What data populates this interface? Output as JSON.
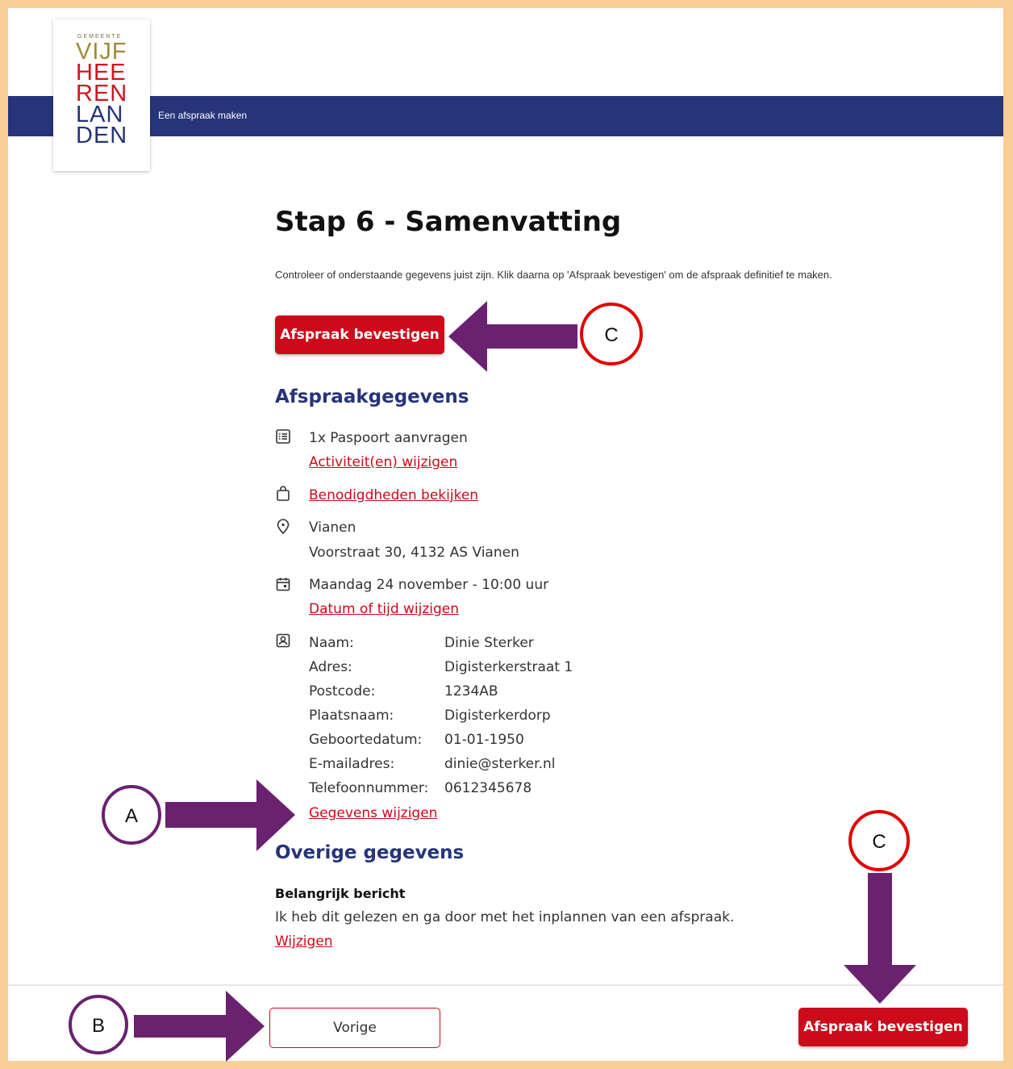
{
  "header": {
    "title": "Een afspraak maken",
    "logo": {
      "small": "GEMEENTE",
      "lines": [
        "VIJF",
        "HEE",
        "REN",
        "LAN",
        "DEN"
      ]
    }
  },
  "page": {
    "title": "Stap 6 - Samenvatting",
    "intro": "Controleer of onderstaande gegevens juist zijn. Klik daarna op 'Afspraak bevestigen' om de afspraak definitief te maken.",
    "confirm_label": "Afspraak bevestigen"
  },
  "afspraak": {
    "heading": "Afspraakgegevens",
    "activity": "1x Paspoort aanvragen",
    "activity_link": "Activiteit(en) wijzigen",
    "needs_link": "Benodigdheden bekijken",
    "location_name": "Vianen",
    "location_address": "Voorstraat 30, 4132 AS Vianen",
    "datetime": "Maandag 24 november - 10:00 uur",
    "datetime_link": "Datum of tijd wijzigen",
    "personal": [
      {
        "label": "Naam:",
        "value": "Dinie Sterker"
      },
      {
        "label": "Adres:",
        "value": "Digisterkerstraat 1"
      },
      {
        "label": "Postcode:",
        "value": "1234AB"
      },
      {
        "label": "Plaatsnaam:",
        "value": "Digisterkerdorp"
      },
      {
        "label": "Geboortedatum:",
        "value": "01-01-1950"
      },
      {
        "label": "E-mailadres:",
        "value": "dinie@sterker.nl"
      },
      {
        "label": "Telefoonnummer:",
        "value": "0612345678"
      }
    ],
    "personal_link": "Gegevens wijzigen"
  },
  "overige": {
    "heading": "Overige gegevens",
    "title": "Belangrijk bericht",
    "text": "Ik heb dit gelezen en ga door met het inplannen van een afspraak.",
    "link": "Wijzigen"
  },
  "footer": {
    "prev_label": "Vorige",
    "confirm_label": "Afspraak bevestigen"
  },
  "annotations": {
    "a": "A",
    "b": "B",
    "c_top": "C",
    "c_bottom": "C"
  },
  "colors": {
    "brand_red": "#cc0a1a",
    "navy": "#263479",
    "frame": "#f8cd96",
    "arrow_purple": "#6a2170"
  }
}
